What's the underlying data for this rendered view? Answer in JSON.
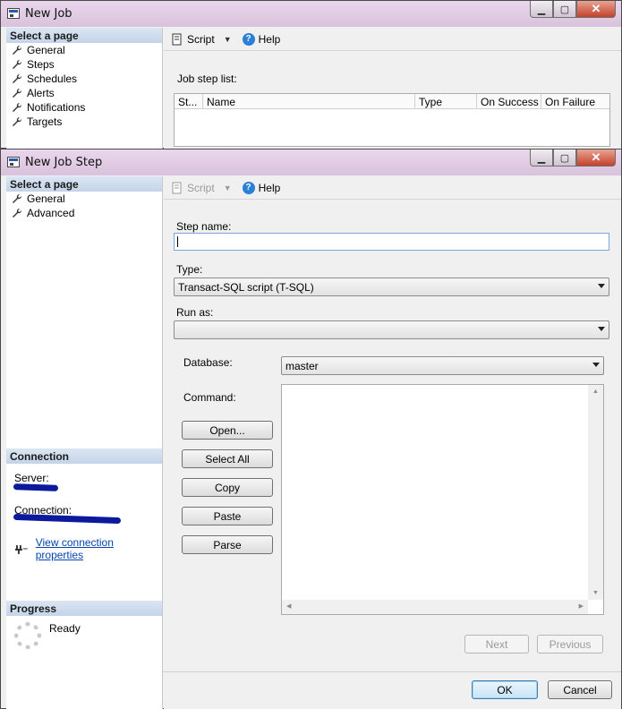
{
  "new_job": {
    "title": "New Job",
    "select_page": "Select a page",
    "pages": [
      "General",
      "Steps",
      "Schedules",
      "Alerts",
      "Notifications",
      "Targets"
    ],
    "toolbar": {
      "script": "Script",
      "help": "Help"
    },
    "job_step_list_label": "Job step list:",
    "grid_columns": [
      "St...",
      "Name",
      "Type",
      "On Success",
      "On Failure"
    ]
  },
  "new_job_step": {
    "title": "New Job Step",
    "select_page": "Select a page",
    "pages": [
      "General",
      "Advanced"
    ],
    "toolbar": {
      "script": "Script",
      "help": "Help"
    },
    "connection": {
      "header": "Connection",
      "server_label": "Server:",
      "connection_label": "Connection:",
      "view_props": "View connection properties"
    },
    "progress": {
      "header": "Progress",
      "status": "Ready"
    },
    "form": {
      "step_name_label": "Step name:",
      "step_name_value": "",
      "type_label": "Type:",
      "type_value": "Transact-SQL script (T-SQL)",
      "run_as_label": "Run as:",
      "run_as_value": "",
      "database_label": "Database:",
      "database_value": "master",
      "command_label": "Command:",
      "command_value": ""
    },
    "command_buttons": {
      "open": "Open...",
      "select_all": "Select All",
      "copy": "Copy",
      "paste": "Paste",
      "parse": "Parse"
    },
    "nav_buttons": {
      "next": "Next",
      "previous": "Previous"
    },
    "footer_buttons": {
      "ok": "OK",
      "cancel": "Cancel"
    }
  },
  "colors": {
    "title_bar": "#e0cce3",
    "section_header": "#cddcee",
    "link": "#0645ad",
    "help_icon": "#2a7fd6"
  },
  "icons": {
    "page_item": "wrench-icon",
    "help": "help-icon",
    "script": "script-icon",
    "connection": "plug-icon",
    "progress": "spinner-icon"
  }
}
